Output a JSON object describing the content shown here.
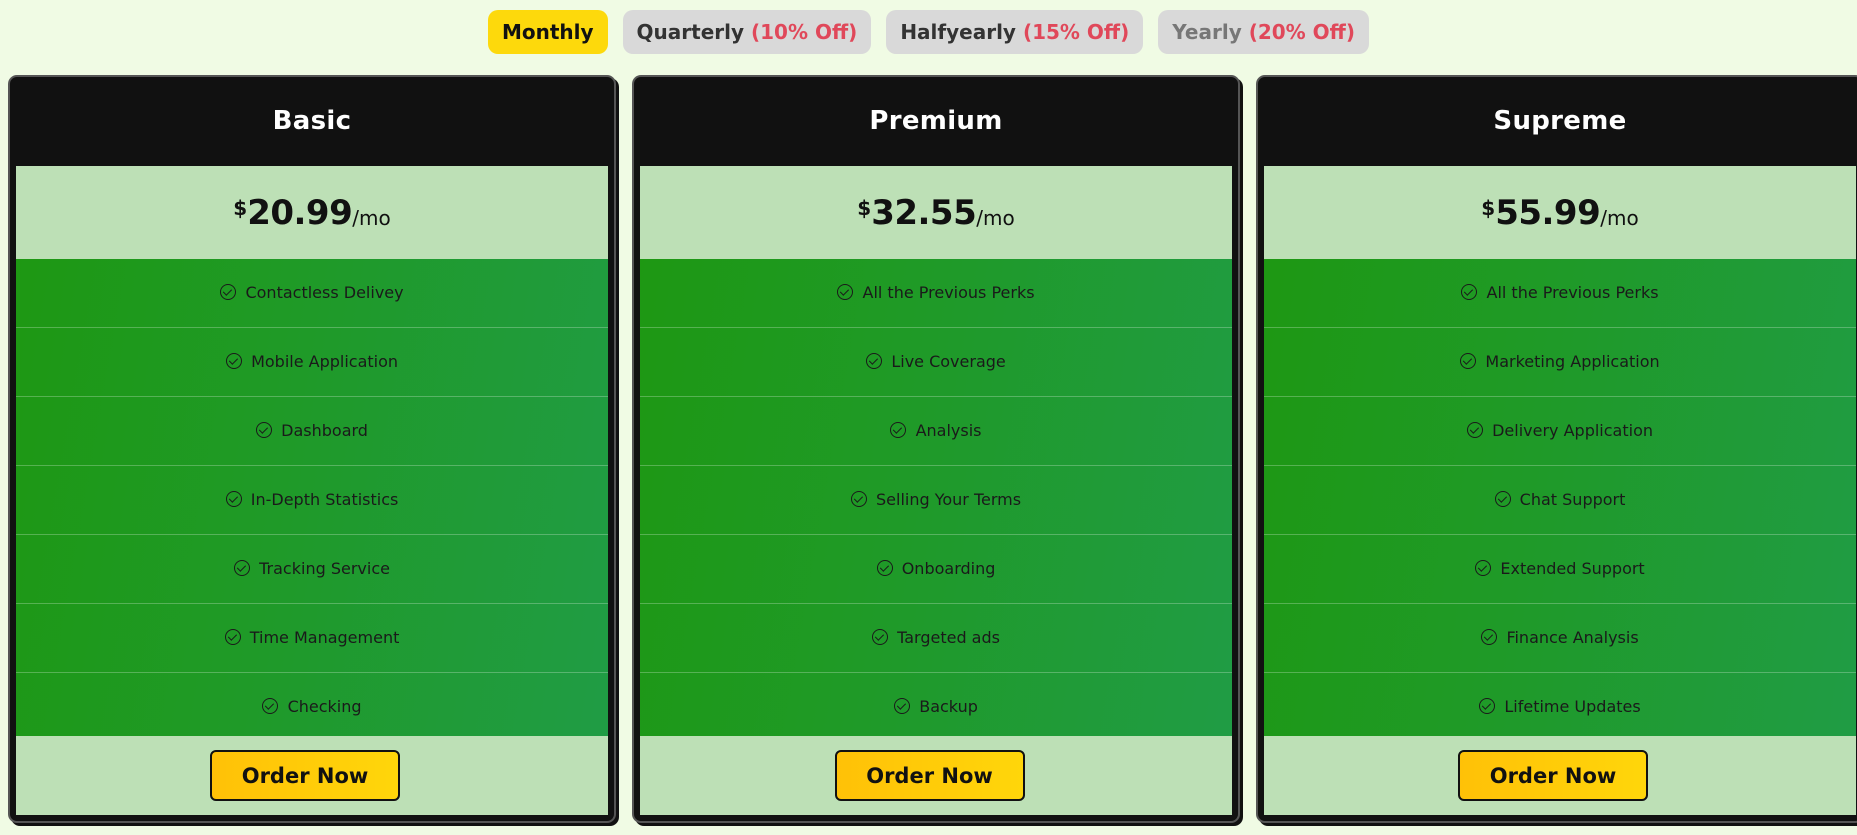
{
  "billing_tabs": [
    {
      "label": "Monthly",
      "discount": ""
    },
    {
      "label": "Quarterly",
      "discount": "(10% Off)"
    },
    {
      "label": "Halfyearly",
      "discount": "(15% Off)"
    },
    {
      "label": "Yearly",
      "discount": "(20% Off)"
    }
  ],
  "active_tab": "Monthly",
  "plans": [
    {
      "name": "Basic",
      "currency": "$",
      "price": "20.99",
      "period": "/mo",
      "features": [
        "Contactless Delivey",
        "Mobile Application",
        "Dashboard",
        "In-Depth Statistics",
        "Tracking Service",
        "Time Management",
        "Checking"
      ],
      "cta": "Order Now"
    },
    {
      "name": "Premium",
      "currency": "$",
      "price": "32.55",
      "period": "/mo",
      "features": [
        "All the Previous Perks",
        "Live Coverage",
        "Analysis",
        "Selling Your Terms",
        "Onboarding",
        "Targeted ads",
        "Backup"
      ],
      "cta": "Order Now"
    },
    {
      "name": "Supreme",
      "currency": "$",
      "price": "55.99",
      "period": "/mo",
      "features": [
        "All the Previous Perks",
        "Marketing Application",
        "Delivery Application",
        "Chat Support",
        "Extended Support",
        "Finance Analysis",
        "Lifetime Updates"
      ],
      "cta": "Order Now"
    }
  ],
  "icons": {
    "feature": "check-circle-icon"
  },
  "colors": {
    "page_bg": "#f0fbe4",
    "active_tab": "#fdd90c",
    "inactive_tab": "#d9d9d9",
    "discount_text": "#e0485a",
    "card_header": "#111111",
    "price_band": "#bde0b6",
    "features_bg": "#1f9a28",
    "order_button": "#ffd60a"
  }
}
